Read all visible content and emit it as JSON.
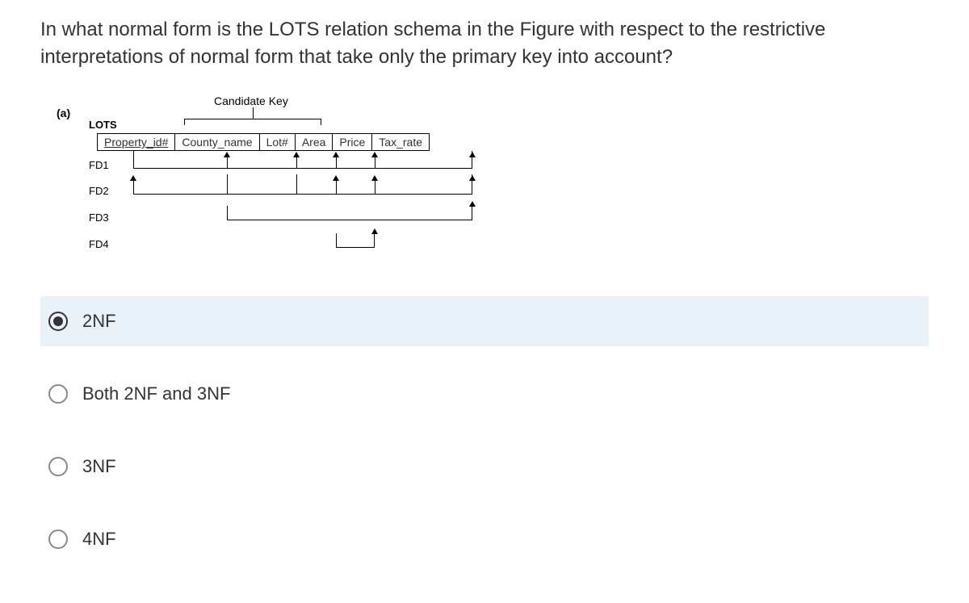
{
  "question": "In what normal form is the LOTS relation schema in the Figure with respect to the restrictive interpretations of normal form that take only the primary key into account?",
  "diagram": {
    "part_label": "(a)",
    "candidate_key_label": "Candidate Key",
    "schema_name": "LOTS",
    "attributes": [
      "Property_id#",
      "County_name",
      "Lot#",
      "Area",
      "Price",
      "Tax_rate"
    ],
    "primary_key": "Property_id#",
    "candidate_key": [
      "County_name",
      "Lot#"
    ],
    "functional_dependencies": {
      "FD1": {
        "determinant": [
          "Property_id#"
        ],
        "dependent": [
          "County_name",
          "Lot#",
          "Area",
          "Price",
          "Tax_rate"
        ]
      },
      "FD2": {
        "determinant": [
          "County_name",
          "Lot#"
        ],
        "dependent": [
          "Property_id#",
          "Area",
          "Price",
          "Tax_rate"
        ]
      },
      "FD3": {
        "determinant": [
          "County_name"
        ],
        "dependent": [
          "Tax_rate"
        ]
      },
      "FD4": {
        "determinant": [
          "Area"
        ],
        "dependent": [
          "Price"
        ]
      }
    },
    "fd_labels": [
      "FD1",
      "FD2",
      "FD3",
      "FD4"
    ]
  },
  "options": [
    {
      "label": "2NF",
      "selected": true
    },
    {
      "label": "Both 2NF and 3NF",
      "selected": false
    },
    {
      "label": "3NF",
      "selected": false
    },
    {
      "label": "4NF",
      "selected": false
    }
  ]
}
